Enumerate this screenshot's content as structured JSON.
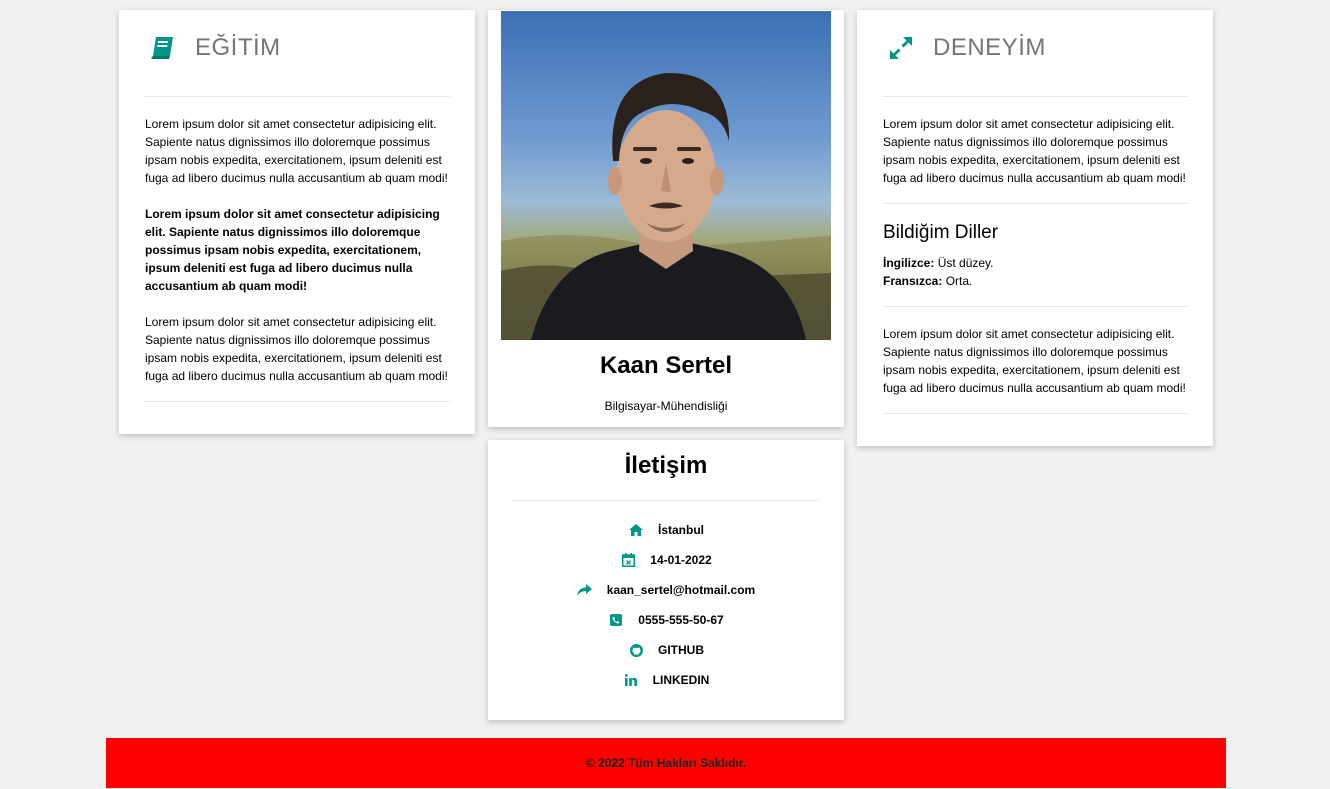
{
  "education": {
    "title": "EĞİTİM",
    "icon": "book-icon",
    "paragraphs": [
      "Lorem ipsum dolor sit amet consectetur adipisicing elit. Sapiente natus dignissimos illo doloremque possimus ipsam nobis expedita, exercitationem, ipsum deleniti est fuga ad libero ducimus nulla accusantium ab quam modi!",
      "Lorem ipsum dolor sit amet consectetur adipisicing elit. Sapiente natus dignissimos illo doloremque possimus ipsam nobis expedita, exercitationem, ipsum deleniti est fuga ad libero ducimus nulla accusantium ab quam modi!",
      "Lorem ipsum dolor sit amet consectetur adipisicing elit. Sapiente natus dignissimos illo doloremque possimus ipsam nobis expedita, exercitationem, ipsum deleniti est fuga ad libero ducimus nulla accusantium ab quam modi!"
    ]
  },
  "profile": {
    "name": "Kaan Sertel",
    "subtitle": "Bilgisayar-Mühendisliği"
  },
  "contact": {
    "title": "İletişim",
    "items": [
      {
        "icon": "home-icon",
        "text": "İstanbul"
      },
      {
        "icon": "calendar-icon",
        "text": "14-01-2022"
      },
      {
        "icon": "share-icon",
        "text": "kaan_sertel@hotmail.com"
      },
      {
        "icon": "phone-icon",
        "text": "0555-555-50-67"
      },
      {
        "icon": "github-icon",
        "text": "GITHUB"
      },
      {
        "icon": "linkedin-icon",
        "text": "LINKEDIN"
      }
    ]
  },
  "experience": {
    "title": "DENEYİM",
    "icon": "expand-icon",
    "paragraph_1": "Lorem ipsum dolor sit amet consectetur adipisicing elit. Sapiente natus dignissimos illo doloremque possimus ipsam nobis expedita, exercitationem, ipsum deleniti est fuga ad libero ducimus nulla accusantium ab quam modi!",
    "languages_title": "Bildiğim Diller",
    "languages": [
      {
        "name": "İngilizce:",
        "level": "Üst düzey."
      },
      {
        "name": "Fransızca:",
        "level": "Orta."
      }
    ],
    "paragraph_2": "Lorem ipsum dolor sit amet consectetur adipisicing elit. Sapiente natus dignissimos illo doloremque possimus ipsam nobis expedita, exercitationem, ipsum deleniti est fuga ad libero ducimus nulla accusantium ab quam modi!"
  },
  "footer": {
    "text": "© 2022 Tüm Hakları Saklıdır."
  },
  "colors": {
    "accent": "#009688",
    "footer_bg": "#ff0000",
    "page_bg": "#f1f1f1"
  }
}
